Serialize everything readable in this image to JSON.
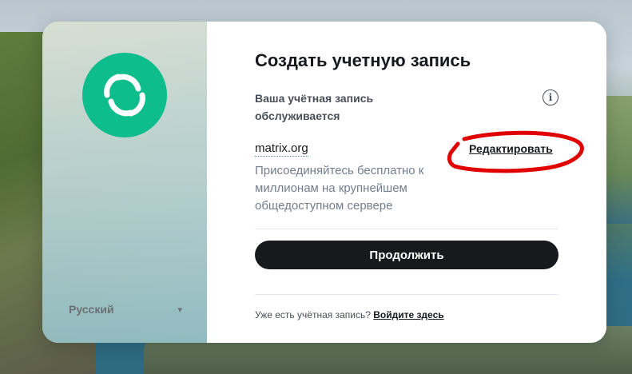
{
  "auth": {
    "title": "Создать учетную запись",
    "server_label": "Ваша учётная запись обслуживается",
    "server_name": "matrix.org",
    "edit_label": "Редактировать",
    "server_description": "Присоединяйтесь бесплатно к миллионам на крупнейшем общедоступном сервере",
    "continue_label": "Продолжить",
    "have_account_text": "Уже есть учётная запись?",
    "login_link": "Войдите здесь",
    "language": "Русский"
  },
  "icons": {
    "logo": "element-logo",
    "info": "info-icon",
    "language_chevron": "chevron-down-icon"
  },
  "colors": {
    "brand": "#0dbd8b",
    "button": "#17191c",
    "annotation": "#e00000"
  }
}
